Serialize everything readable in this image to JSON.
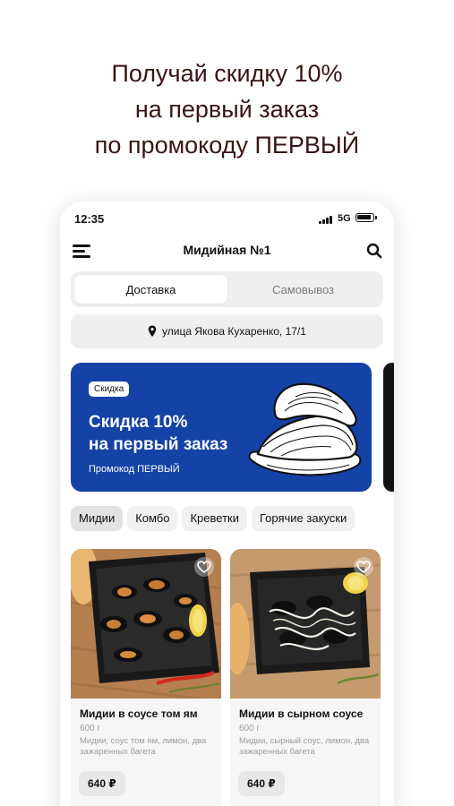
{
  "promo_header": {
    "line1": "Получай скидку 10%",
    "line2": "на первый заказ",
    "line3": "по промокоду ПЕРВЫЙ"
  },
  "status_bar": {
    "time": "12:35",
    "network": "5G"
  },
  "header": {
    "title": "Мидийная №1",
    "menu_icon": "hamburger-icon",
    "search_icon": "search-icon"
  },
  "delivery_toggle": {
    "options": [
      "Доставка",
      "Самовывоз"
    ],
    "selected": "Доставка"
  },
  "address": {
    "icon": "location-pin-icon",
    "text": "улица Якова Кухаренко, 17/1"
  },
  "banner": {
    "badge": "Скидка",
    "headline_line1": "Скидка 10%",
    "headline_line2": "на первый заказ",
    "promo_text": "Промокод ПЕРВЫЙ",
    "background": "#1442a6"
  },
  "categories": [
    "Мидии",
    "Комбо",
    "Креветки",
    "Горячие закуски"
  ],
  "active_category": "Мидии",
  "products": [
    {
      "name": "Мидии в соусе том ям",
      "weight": "600 г",
      "description": "Мидии, соус том ям, лимон, два зажаренных багета",
      "price": "640 ₽"
    },
    {
      "name": "Мидии в сырном соусе",
      "weight": "600 г",
      "description": "Мидии, сырный соус, лимон, два зажаренных багета",
      "price": "640 ₽"
    }
  ]
}
